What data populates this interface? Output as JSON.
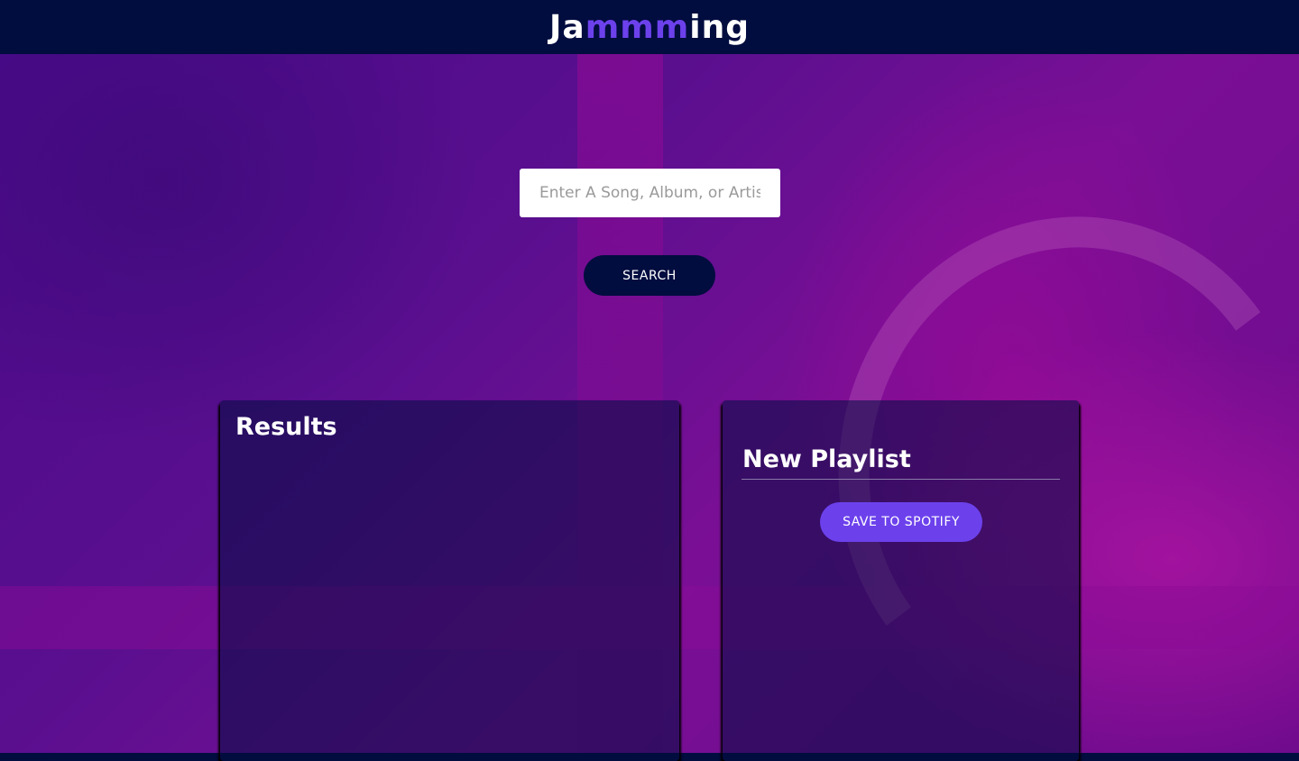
{
  "header": {
    "logo_part1": "Ja",
    "logo_highlight": "mmm",
    "logo_part2": "ing"
  },
  "search": {
    "placeholder": "Enter A Song, Album, or Artist",
    "button_label": "SEARCH"
  },
  "results": {
    "title": "Results"
  },
  "playlist": {
    "name_value": "New Playlist",
    "save_label": "SAVE TO SPOTIFY"
  },
  "colors": {
    "header_bg": "#010c3f",
    "accent": "#6c41ec",
    "panel_bg": "rgba(1,12,63,0.55)"
  }
}
